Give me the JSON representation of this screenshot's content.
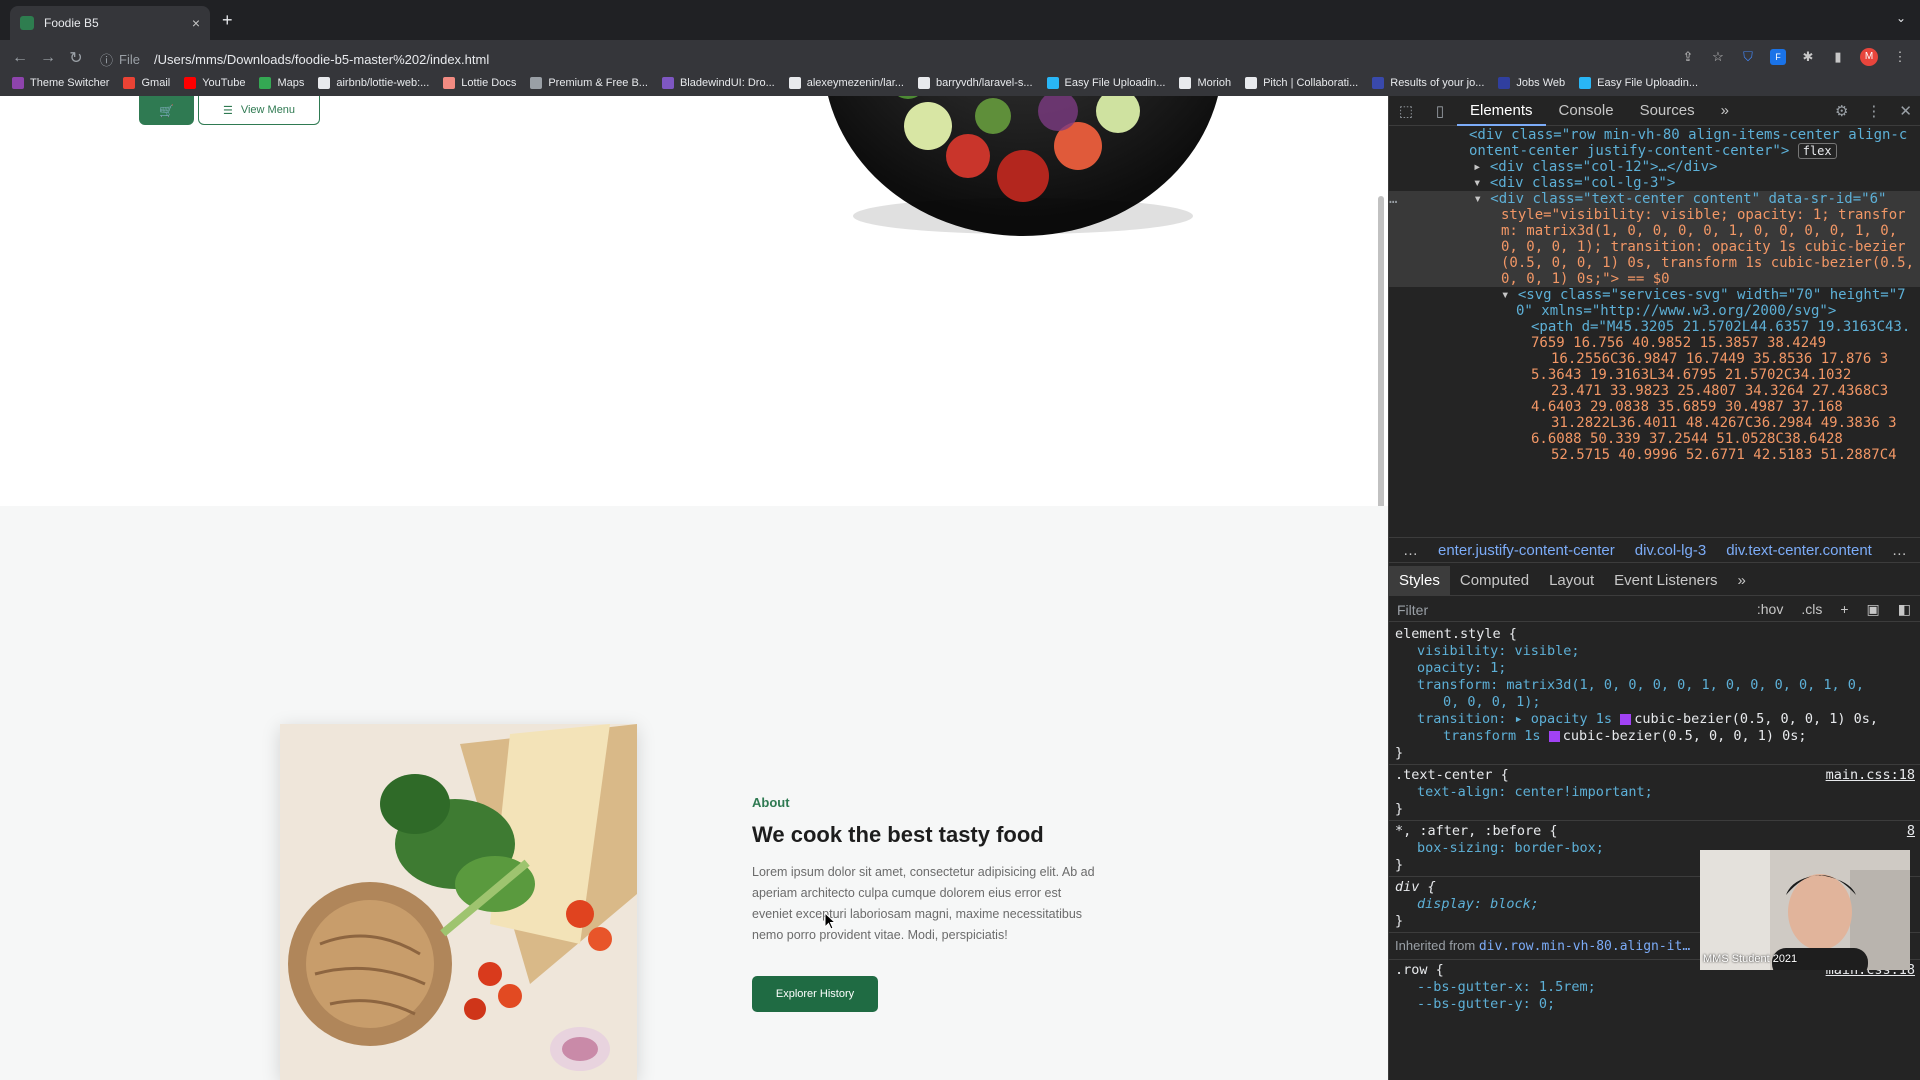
{
  "browser": {
    "tab_title": "Foodie B5",
    "tab_close": "×",
    "new_tab": "+",
    "url_prefix": "File",
    "url": "/Users/mms/Downloads/foodie-b5-master%202/index.html",
    "profile_initial": "M",
    "bookmarks": [
      {
        "label": "Theme Switcher",
        "color": "#8e44ad"
      },
      {
        "label": "Gmail",
        "color": "#ea4335"
      },
      {
        "label": "YouTube",
        "color": "#ff0000"
      },
      {
        "label": "Maps",
        "color": "#34a853"
      },
      {
        "label": "airbnb/lottie-web:...",
        "color": "#e8eaed"
      },
      {
        "label": "Lottie Docs",
        "color": "#f28b82"
      },
      {
        "label": "Premium & Free B...",
        "color": "#9aa0a6"
      },
      {
        "label": "BladewindUI: Dro...",
        "color": "#7e57c2"
      },
      {
        "label": "alexeymezenin/lar...",
        "color": "#e8eaed"
      },
      {
        "label": "barryvdh/laravel-s...",
        "color": "#e8eaed"
      },
      {
        "label": "Easy File Uploadin...",
        "color": "#29b6f6"
      },
      {
        "label": "Morioh",
        "color": "#e8eaed"
      },
      {
        "label": "Pitch | Collaborati...",
        "color": "#e8eaed"
      },
      {
        "label": "Results of your jo...",
        "color": "#3949ab"
      },
      {
        "label": "Jobs Web",
        "color": "#303f9f"
      },
      {
        "label": "Easy File Uploadin...",
        "color": "#29b6f6"
      }
    ]
  },
  "page": {
    "view_menu": "View Menu",
    "about_label": "About",
    "about_title": "We cook the best tasty food",
    "about_text": "Lorem ipsum dolor sit amet, consectetur adipisicing elit. Ab ad aperiam architecto culpa cumque dolorem eius error est eveniet excepturi laboriosam magni, maxime necessitatibus nemo porro provident vitae. Modi, perspiciatis!",
    "history_button": "Explorer History",
    "accent_color": "#2f7a52"
  },
  "devtools": {
    "tabs": [
      "Elements",
      "Console",
      "Sources"
    ],
    "more": "»",
    "dom_lines": {
      "l0a": "<div class=\"row min-vh-80 align-items-center align-c",
      "l0b": "ontent-center justify-content-center\">",
      "flex_badge": "flex",
      "l1": "<div class=\"col-12\">…</div>",
      "l2": "<div class=\"col-lg-3\">",
      "l3": "<div class=\"text-center content\" data-sr-id=\"6\"",
      "l4": "style=\"visibility: visible; opacity: 1; transfor",
      "l5": "m: matrix3d(1, 0, 0, 0, 0, 1, 0, 0, 0, 0, 1, 0,",
      "l6": "0, 0, 0, 1); transition: opacity 1s cubic-bezier",
      "l7": "(0.5, 0, 0, 1) 0s, transform 1s cubic-bezier(0.5,",
      "l8": "0, 0, 1) 0s;\"> == $0",
      "l9": "<svg class=\"services-svg\" width=\"70\" height=\"7",
      "l10": "0\" xmlns=\"http://www.w3.org/2000/svg\">",
      "l11": "<path d=\"M45.3205 21.5702L44.6357 19.3163C43.",
      "l12": "7659 16.756 40.9852 15.3857 38.4249",
      "l13": "16.2556C36.9847 16.7449 35.8536 17.876 3",
      "l14": "5.3643 19.3163L34.6795 21.5702C34.1032",
      "l15": "23.471 33.9823 25.4807 34.3264 27.4368C3",
      "l16": "4.6403 29.0838 35.6859 30.4987 37.168",
      "l17": "31.2822L36.4011 48.4267C36.2984 49.3836 3",
      "l18": "6.6088 50.339 37.2544 51.0528C38.6428",
      "l19": "52.5715 40.9996 52.6771 42.5183 51.2887C4"
    },
    "breadcrumb": [
      "…",
      "enter.justify-content-center",
      "div.col-lg-3",
      "div.text-center.content",
      "…"
    ],
    "sub_tabs": [
      "Styles",
      "Computed",
      "Layout",
      "Event Listeners"
    ],
    "filter_placeholder": "Filter",
    "filter_tools": [
      ":hov",
      ".cls",
      "+"
    ],
    "styles": {
      "element_style": "element.style {",
      "p_visibility": "visibility: visible;",
      "p_opacity": "opacity: 1;",
      "p_transform": "transform: matrix3d(1, 0, 0, 0, 0, 1, 0, 0, 0, 0, 1, 0,",
      "p_transform2": "0, 0, 0, 1);",
      "p_transition": "transition: ▸ opacity 1s",
      "p_transition_curve": "cubic-bezier(0.5, 0, 0, 1) 0s,",
      "p_transition2": "transform 1s",
      "p_transition2_curve": "cubic-bezier(0.5, 0, 0, 1) 0s;",
      "close": "}",
      "text_center_sel": ".text-center {",
      "text_center_src": "main.css:18",
      "p_text_align": "text-align: center!important;",
      "universal_sel": "*, :after, :before {",
      "universal_src": "8",
      "p_box_sizing": "box-sizing: border-box;",
      "div_sel": "div {",
      "p_display": "display: block;",
      "inherited_label": "Inherited from",
      "inherited_from": "div.row.min-vh-80.align-it…",
      "row_sel": ".row {",
      "row_src": "main.css:18",
      "p_gutter_x": "--bs-gutter-x: 1.5rem;",
      "p_gutter_y": "--bs-gutter-y: 0;"
    },
    "webcam_label": "MMS Student 2021"
  }
}
